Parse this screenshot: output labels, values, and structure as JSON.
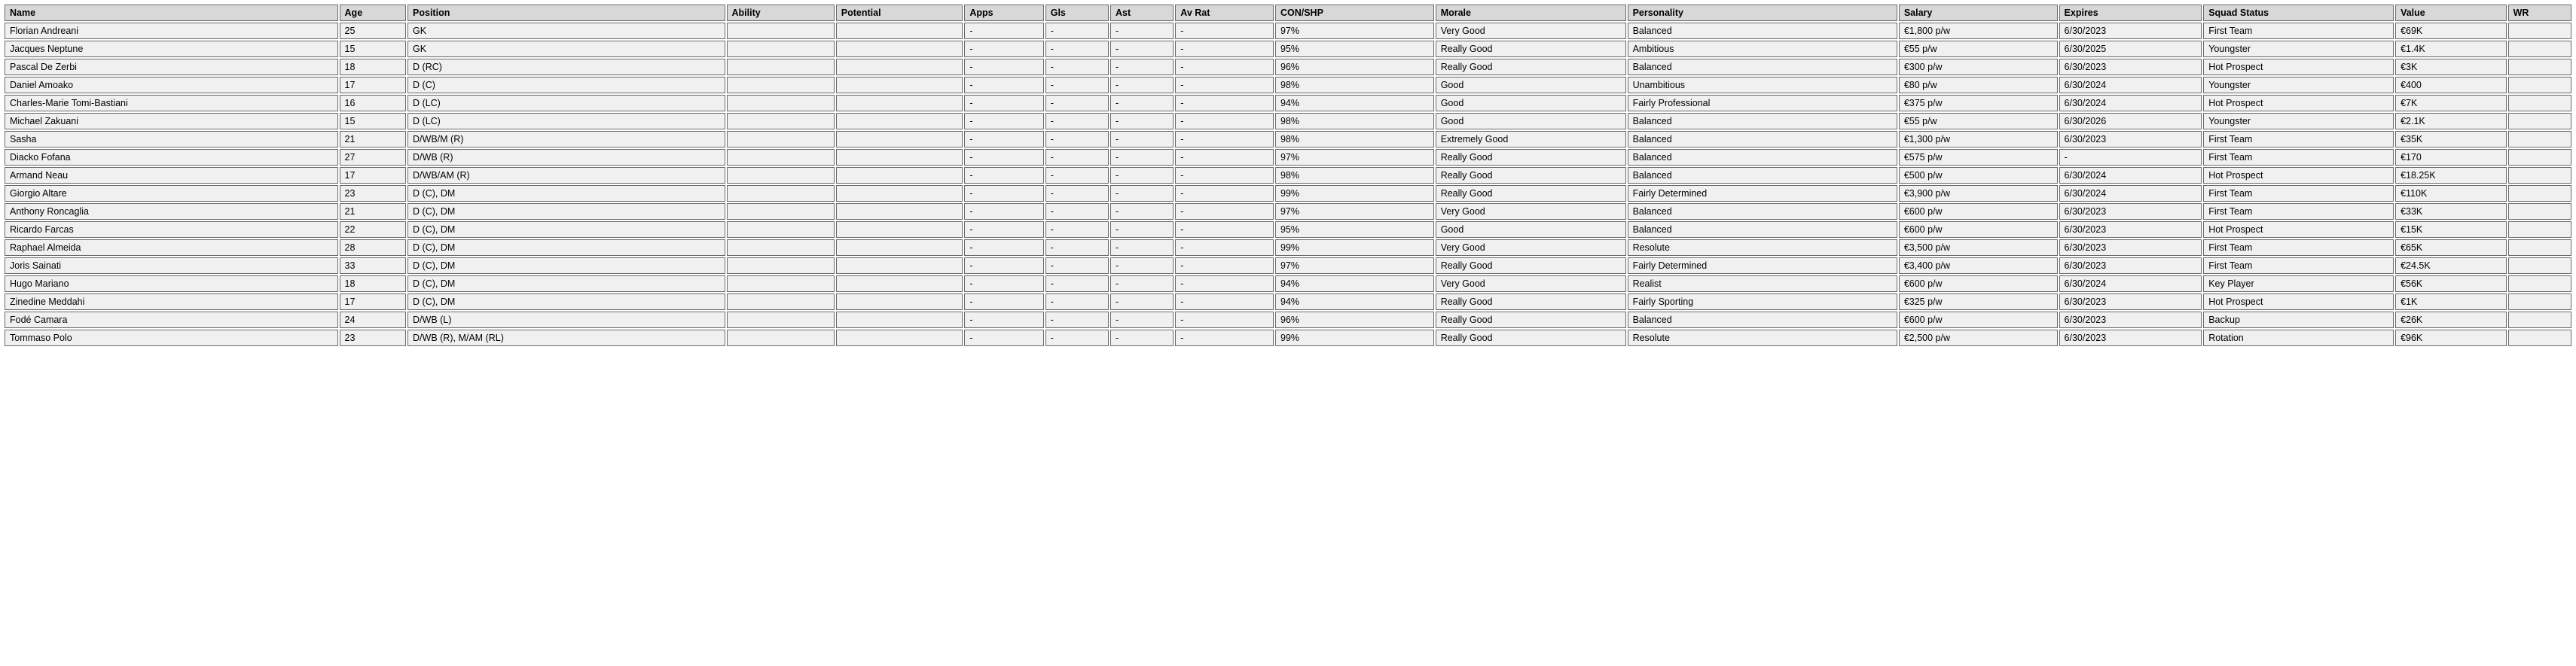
{
  "columns": [
    {
      "key": "name",
      "label": "Name",
      "cls": "c-name"
    },
    {
      "key": "age",
      "label": "Age",
      "cls": "c-age"
    },
    {
      "key": "position",
      "label": "Position",
      "cls": "c-pos"
    },
    {
      "key": "ability",
      "label": "Ability",
      "cls": "c-ability"
    },
    {
      "key": "potential",
      "label": "Potential",
      "cls": "c-potential"
    },
    {
      "key": "apps",
      "label": "Apps",
      "cls": "c-apps"
    },
    {
      "key": "gls",
      "label": "Gls",
      "cls": "c-gls"
    },
    {
      "key": "ast",
      "label": "Ast",
      "cls": "c-ast"
    },
    {
      "key": "avrat",
      "label": "Av Rat",
      "cls": "c-avrat"
    },
    {
      "key": "con",
      "label": "CON/SHP",
      "cls": "c-con"
    },
    {
      "key": "morale",
      "label": "Morale",
      "cls": "c-morale"
    },
    {
      "key": "personality",
      "label": "Personality",
      "cls": "c-personality"
    },
    {
      "key": "salary",
      "label": "Salary",
      "cls": "c-salary"
    },
    {
      "key": "expires",
      "label": "Expires",
      "cls": "c-expires"
    },
    {
      "key": "squad",
      "label": "Squad Status",
      "cls": "c-squad"
    },
    {
      "key": "value",
      "label": "Value",
      "cls": "c-value"
    },
    {
      "key": "wr",
      "label": "WR",
      "cls": "c-wr"
    }
  ],
  "rows": [
    {
      "name": "Florian Andreani",
      "age": "25",
      "position": "GK",
      "ability": "",
      "potential": "",
      "apps": "-",
      "gls": "-",
      "ast": "-",
      "avrat": "-",
      "con": "97%",
      "morale": "Very Good",
      "personality": "Balanced",
      "salary": "€1,800 p/w",
      "expires": "6/30/2023",
      "squad": "First Team",
      "value": "€69K",
      "wr": ""
    },
    {
      "name": "Jacques Neptune",
      "age": "15",
      "position": "GK",
      "ability": "",
      "potential": "",
      "apps": "-",
      "gls": "-",
      "ast": "-",
      "avrat": "-",
      "con": "95%",
      "morale": "Really Good",
      "personality": "Ambitious",
      "salary": "€55 p/w",
      "expires": "6/30/2025",
      "squad": "Youngster",
      "value": "€1.4K",
      "wr": ""
    },
    {
      "name": "Pascal De Zerbi",
      "age": "18",
      "position": "D (RC)",
      "ability": "",
      "potential": "",
      "apps": "-",
      "gls": "-",
      "ast": "-",
      "avrat": "-",
      "con": "96%",
      "morale": "Really Good",
      "personality": "Balanced",
      "salary": "€300 p/w",
      "expires": "6/30/2023",
      "squad": "Hot Prospect",
      "value": "€3K",
      "wr": ""
    },
    {
      "name": "Daniel Amoako",
      "age": "17",
      "position": "D (C)",
      "ability": "",
      "potential": "",
      "apps": "-",
      "gls": "-",
      "ast": "-",
      "avrat": "-",
      "con": "98%",
      "morale": "Good",
      "personality": "Unambitious",
      "salary": "€80 p/w",
      "expires": "6/30/2024",
      "squad": "Youngster",
      "value": "€400",
      "wr": ""
    },
    {
      "name": "Charles-Marie Tomi-Bastiani",
      "age": "16",
      "position": "D (LC)",
      "ability": "",
      "potential": "",
      "apps": "-",
      "gls": "-",
      "ast": "-",
      "avrat": "-",
      "con": "94%",
      "morale": "Good",
      "personality": "Fairly Professional",
      "salary": "€375 p/w",
      "expires": "6/30/2024",
      "squad": "Hot Prospect",
      "value": "€7K",
      "wr": ""
    },
    {
      "name": "Michael Zakuani",
      "age": "15",
      "position": "D (LC)",
      "ability": "",
      "potential": "",
      "apps": "-",
      "gls": "-",
      "ast": "-",
      "avrat": "-",
      "con": "98%",
      "morale": "Good",
      "personality": "Balanced",
      "salary": "€55 p/w",
      "expires": "6/30/2026",
      "squad": "Youngster",
      "value": "€2.1K",
      "wr": ""
    },
    {
      "name": "Sasha",
      "age": "21",
      "position": "D/WB/M (R)",
      "ability": "",
      "potential": "",
      "apps": "-",
      "gls": "-",
      "ast": "-",
      "avrat": "-",
      "con": "98%",
      "morale": "Extremely Good",
      "personality": "Balanced",
      "salary": "€1,300 p/w",
      "expires": "6/30/2023",
      "squad": "First Team",
      "value": "€35K",
      "wr": ""
    },
    {
      "name": "Diacko Fofana",
      "age": "27",
      "position": "D/WB (R)",
      "ability": "",
      "potential": "",
      "apps": "-",
      "gls": "-",
      "ast": "-",
      "avrat": "-",
      "con": "97%",
      "morale": "Really Good",
      "personality": "Balanced",
      "salary": "€575 p/w",
      "expires": "-",
      "squad": "First Team",
      "value": "€170",
      "wr": ""
    },
    {
      "name": "Armand Neau",
      "age": "17",
      "position": "D/WB/AM (R)",
      "ability": "",
      "potential": "",
      "apps": "-",
      "gls": "-",
      "ast": "-",
      "avrat": "-",
      "con": "98%",
      "morale": "Really Good",
      "personality": "Balanced",
      "salary": "€500 p/w",
      "expires": "6/30/2024",
      "squad": "Hot Prospect",
      "value": "€18.25K",
      "wr": ""
    },
    {
      "name": "Giorgio Altare",
      "age": "23",
      "position": "D (C), DM",
      "ability": "",
      "potential": "",
      "apps": "-",
      "gls": "-",
      "ast": "-",
      "avrat": "-",
      "con": "99%",
      "morale": "Really Good",
      "personality": "Fairly Determined",
      "salary": "€3,900 p/w",
      "expires": "6/30/2024",
      "squad": "First Team",
      "value": "€110K",
      "wr": ""
    },
    {
      "name": "Anthony Roncaglia",
      "age": "21",
      "position": "D (C), DM",
      "ability": "",
      "potential": "",
      "apps": "-",
      "gls": "-",
      "ast": "-",
      "avrat": "-",
      "con": "97%",
      "morale": "Very Good",
      "personality": "Balanced",
      "salary": "€600 p/w",
      "expires": "6/30/2023",
      "squad": "First Team",
      "value": "€33K",
      "wr": ""
    },
    {
      "name": "Ricardo Farcas",
      "age": "22",
      "position": "D (C), DM",
      "ability": "",
      "potential": "",
      "apps": "-",
      "gls": "-",
      "ast": "-",
      "avrat": "-",
      "con": "95%",
      "morale": "Good",
      "personality": "Balanced",
      "salary": "€600 p/w",
      "expires": "6/30/2023",
      "squad": "Hot Prospect",
      "value": "€15K",
      "wr": ""
    },
    {
      "name": "Raphael Almeida",
      "age": "28",
      "position": "D (C), DM",
      "ability": "",
      "potential": "",
      "apps": "-",
      "gls": "-",
      "ast": "-",
      "avrat": "-",
      "con": "99%",
      "morale": "Very Good",
      "personality": "Resolute",
      "salary": "€3,500 p/w",
      "expires": "6/30/2023",
      "squad": "First Team",
      "value": "€65K",
      "wr": ""
    },
    {
      "name": "Joris Sainati",
      "age": "33",
      "position": "D (C), DM",
      "ability": "",
      "potential": "",
      "apps": "-",
      "gls": "-",
      "ast": "-",
      "avrat": "-",
      "con": "97%",
      "morale": "Really Good",
      "personality": "Fairly Determined",
      "salary": "€3,400 p/w",
      "expires": "6/30/2023",
      "squad": "First Team",
      "value": "€24.5K",
      "wr": ""
    },
    {
      "name": "Hugo Mariano",
      "age": "18",
      "position": "D (C), DM",
      "ability": "",
      "potential": "",
      "apps": "-",
      "gls": "-",
      "ast": "-",
      "avrat": "-",
      "con": "94%",
      "morale": "Very Good",
      "personality": "Realist",
      "salary": "€600 p/w",
      "expires": "6/30/2024",
      "squad": "Key Player",
      "value": "€56K",
      "wr": ""
    },
    {
      "name": "Zinedine Meddahi",
      "age": "17",
      "position": "D (C), DM",
      "ability": "",
      "potential": "",
      "apps": "-",
      "gls": "-",
      "ast": "-",
      "avrat": "-",
      "con": "94%",
      "morale": "Really Good",
      "personality": "Fairly Sporting",
      "salary": "€325 p/w",
      "expires": "6/30/2023",
      "squad": "Hot Prospect",
      "value": "€1K",
      "wr": ""
    },
    {
      "name": "Fodé Camara",
      "age": "24",
      "position": "D/WB (L)",
      "ability": "",
      "potential": "",
      "apps": "-",
      "gls": "-",
      "ast": "-",
      "avrat": "-",
      "con": "96%",
      "morale": "Really Good",
      "personality": "Balanced",
      "salary": "€600 p/w",
      "expires": "6/30/2023",
      "squad": "Backup",
      "value": "€26K",
      "wr": ""
    },
    {
      "name": "Tommaso Polo",
      "age": "23",
      "position": "D/WB (R), M/AM (RL)",
      "ability": "",
      "potential": "",
      "apps": "-",
      "gls": "-",
      "ast": "-",
      "avrat": "-",
      "con": "99%",
      "morale": "Really Good",
      "personality": "Resolute",
      "salary": "€2,500 p/w",
      "expires": "6/30/2023",
      "squad": "Rotation",
      "value": "€96K",
      "wr": ""
    }
  ]
}
